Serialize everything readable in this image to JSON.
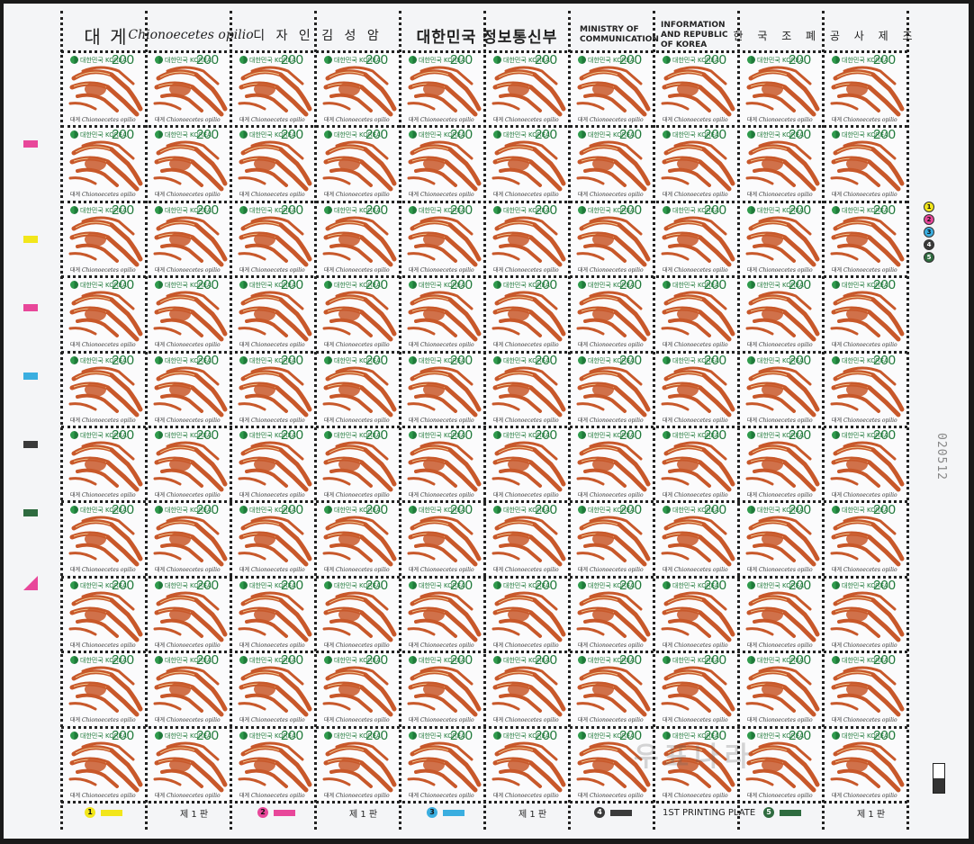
{
  "header": {
    "name_ko": "대 게",
    "name_sci": "Chionoecetes opilio",
    "designer": "디 자 인  김 성 암",
    "country_ko": "대한민국  정보통신부",
    "ministry_en": "MINISTRY OF COMMUNICATION",
    "country_en": "INFORMATION AND REPUBLIC OF KOREA",
    "printer": "한 국 조 폐 공 사 제 조"
  },
  "stamp": {
    "country": "대한민국 KOREA",
    "face_value": "200",
    "caption_ko": "대게",
    "caption_sci": "Chionoecetes opilio"
  },
  "sheet": {
    "rows": 10,
    "cols": 10,
    "serial_number": "020512"
  },
  "footer": {
    "plate_label": "제 1 판",
    "first_printing_plate": "1ST PRINTING PLATE",
    "color_markers": [
      {
        "num": "1",
        "color": "#f2e61b"
      },
      {
        "num": "2",
        "color": "#e8479a"
      },
      {
        "num": "3",
        "color": "#3aaee0"
      },
      {
        "num": "4",
        "color": "#3a3a3a"
      },
      {
        "num": "5",
        "color": "#2e6b3f"
      }
    ]
  },
  "registration_bars": [
    "#e8479a",
    "#f2e61b",
    "#e8479a",
    "#3aaee0",
    "#3a3a3a",
    "#2e6b3f"
  ],
  "watermark": "우표나라",
  "colors": {
    "crab": "#c8582a",
    "green": "#1f7a3a"
  }
}
